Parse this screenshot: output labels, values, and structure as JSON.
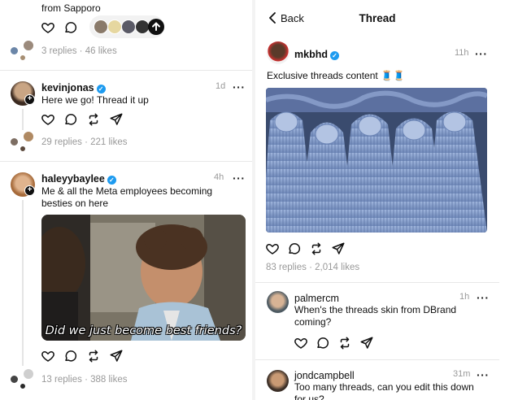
{
  "left": {
    "top_fragment": "from Sapporo",
    "post0": {
      "replies": "3 replies",
      "likes": "46 likes",
      "meta_sep": " · "
    },
    "post1": {
      "username": "kevinjonas",
      "time": "1d",
      "text": "Here we go! Thread it up",
      "replies": "29 replies",
      "likes": "221 likes"
    },
    "post2": {
      "username": "haleyybaylee",
      "time": "4h",
      "text": "Me & all the Meta employees becoming besties on here",
      "caption": "Did we just become best friends?",
      "replies": "13 replies",
      "likes": "388 likes"
    }
  },
  "right": {
    "header": {
      "back_label": "Back",
      "title": "Thread"
    },
    "main": {
      "username": "mkbhd",
      "time": "11h",
      "text": "Exclusive threads content 🧵🧵",
      "replies": "83 replies",
      "likes": "2,014 likes"
    },
    "reply1": {
      "username": "palmercm",
      "time": "1h",
      "text": "When's the threads skin from DBrand coming?"
    },
    "reply2": {
      "username": "jondcampbell",
      "time": "31m",
      "text": "Too many threads, can you edit this down for us?"
    }
  },
  "icons": [
    "heart-icon",
    "comment-icon",
    "repost-icon",
    "share-icon",
    "more-icon",
    "verified-icon",
    "back-chevron-icon",
    "arrow-up-icon"
  ],
  "colors": {
    "verified": "#1d9bf0",
    "text": "#101010",
    "muted": "#999999",
    "yarn": "#7f9bc9"
  }
}
